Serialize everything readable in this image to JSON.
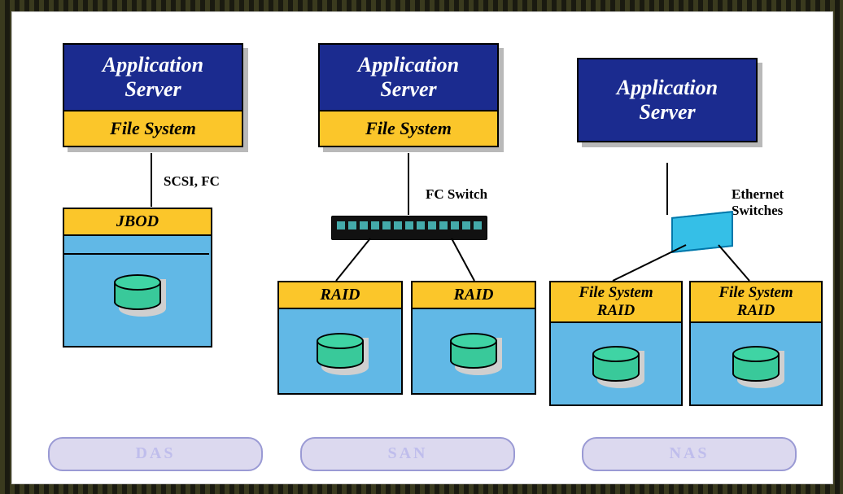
{
  "columns": {
    "das": {
      "app_title_l1": "Application",
      "app_title_l2": "Server",
      "fs_label": "File System",
      "conn_label": "SCSI, FC",
      "storage_head": "JBOD",
      "pill": "DAS"
    },
    "san": {
      "app_title_l1": "Application",
      "app_title_l2": "Server",
      "fs_label": "File System",
      "conn_label": "FC Switch",
      "storage_left_head": "RAID",
      "storage_right_head": "RAID",
      "pill": "SAN"
    },
    "nas": {
      "app_title_l1": "Application",
      "app_title_l2": "Server",
      "conn_label": "Ethernet\nSwitches",
      "storage_left_l1": "File System",
      "storage_left_l2": "RAID",
      "storage_right_l1": "File System",
      "storage_right_l2": "RAID",
      "pill": "NAS"
    }
  },
  "colors": {
    "header_bg": "#1b2b8f",
    "band_bg": "#fbc62a",
    "storage_bg": "#61b8e6",
    "disk": "#3fd4a4",
    "pill_bg": "#dcd9ef"
  }
}
